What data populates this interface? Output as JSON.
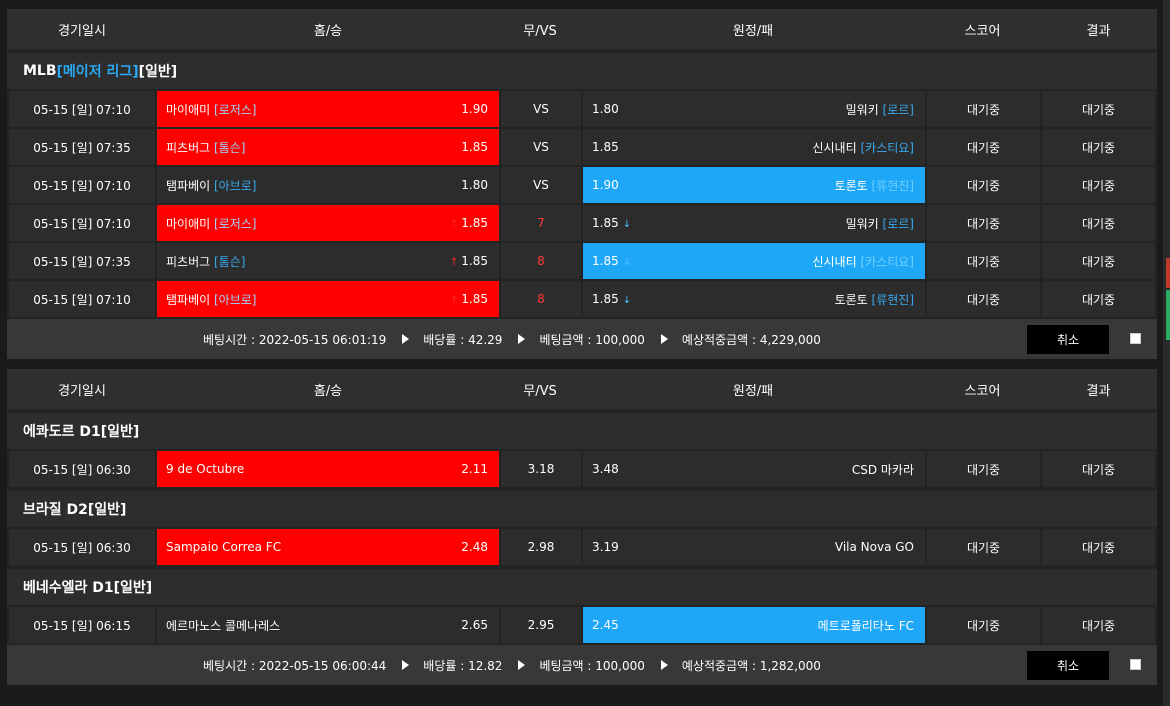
{
  "header": {
    "date": "경기일시",
    "home": "홈/승",
    "vs": "무/VS",
    "away": "원정/패",
    "score": "스코어",
    "result": "결과"
  },
  "slips": [
    {
      "groups": [
        {
          "league": {
            "name": "MLB",
            "tag": "[메이저 리그]",
            "type": "[일반]"
          },
          "rows": [
            {
              "date": "05-15 [일] 07:10",
              "home": "마이애미",
              "home_pitcher": "[로저스]",
              "home_odds": "1.90",
              "home_arrow": "",
              "vs": "VS",
              "vs_red": false,
              "away_odds": "1.80",
              "away_arrow": "",
              "away": "밀워키",
              "away_pitcher": "[로르]",
              "score": "대기중",
              "result": "대기중",
              "pick": "home"
            },
            {
              "date": "05-15 [일] 07:35",
              "home": "피츠버그",
              "home_pitcher": "[톰슨]",
              "home_odds": "1.85",
              "home_arrow": "",
              "vs": "VS",
              "vs_red": false,
              "away_odds": "1.85",
              "away_arrow": "",
              "away": "신시내티",
              "away_pitcher": "[카스티요]",
              "score": "대기중",
              "result": "대기중",
              "pick": "home"
            },
            {
              "date": "05-15 [일] 07:10",
              "home": "탬파베이",
              "home_pitcher": "[아브로]",
              "home_odds": "1.80",
              "home_arrow": "",
              "vs": "VS",
              "vs_red": false,
              "away_odds": "1.90",
              "away_arrow": "",
              "away": "토론토",
              "away_pitcher": "[류현진]",
              "score": "대기중",
              "result": "대기중",
              "pick": "away"
            },
            {
              "date": "05-15 [일] 07:10",
              "home": "마이애미",
              "home_pitcher": "[로저스]",
              "home_odds": "1.85",
              "home_arrow": "↑",
              "vs": "7",
              "vs_red": true,
              "away_odds": "1.85",
              "away_arrow": "↓",
              "away": "밀워키",
              "away_pitcher": "[로르]",
              "score": "대기중",
              "result": "대기중",
              "pick": "home"
            },
            {
              "date": "05-15 [일] 07:35",
              "home": "피츠버그",
              "home_pitcher": "[톰슨]",
              "home_odds": "1.85",
              "home_arrow": "↑",
              "vs": "8",
              "vs_red": true,
              "away_odds": "1.85",
              "away_arrow": "↓",
              "away": "신시내티",
              "away_pitcher": "[카스티요]",
              "score": "대기중",
              "result": "대기중",
              "pick": "away"
            },
            {
              "date": "05-15 [일] 07:10",
              "home": "탬파베이",
              "home_pitcher": "[아브로]",
              "home_odds": "1.85",
              "home_arrow": "↑",
              "vs": "8",
              "vs_red": true,
              "away_odds": "1.85",
              "away_arrow": "↓",
              "away": "토론토",
              "away_pitcher": "[류현진]",
              "score": "대기중",
              "result": "대기중",
              "pick": "home"
            }
          ]
        }
      ],
      "summary": {
        "time": "베팅시간 : 2022-05-15 06:01:19",
        "rate": "배당률 : 42.29",
        "amount": "베팅금액 : 100,000",
        "expected": "예상적중금액 : 4,229,000",
        "cancel": "취소"
      }
    },
    {
      "groups": [
        {
          "league": {
            "name": "에콰도르 D1",
            "tag": "",
            "type": "[일반]"
          },
          "rows": [
            {
              "date": "05-15 [일] 06:30",
              "home": "9 de Octubre",
              "home_pitcher": "",
              "home_odds": "2.11",
              "home_arrow": "",
              "vs": "3.18",
              "vs_red": false,
              "away_odds": "3.48",
              "away_arrow": "",
              "away": "CSD 마카라",
              "away_pitcher": "",
              "score": "대기중",
              "result": "대기중",
              "pick": "home"
            }
          ]
        },
        {
          "league": {
            "name": "브라질 D2",
            "tag": "",
            "type": "[일반]"
          },
          "rows": [
            {
              "date": "05-15 [일] 06:30",
              "home": "Sampaio Correa FC",
              "home_pitcher": "",
              "home_odds": "2.48",
              "home_arrow": "",
              "vs": "2.98",
              "vs_red": false,
              "away_odds": "3.19",
              "away_arrow": "",
              "away": "Vila Nova GO",
              "away_pitcher": "",
              "score": "대기중",
              "result": "대기중",
              "pick": "home"
            }
          ]
        },
        {
          "league": {
            "name": "베네수엘라 D1",
            "tag": "",
            "type": "[일반]"
          },
          "rows": [
            {
              "date": "05-15 [일] 06:15",
              "home": "에르마노스 콜메나레스",
              "home_pitcher": "",
              "home_odds": "2.65",
              "home_arrow": "",
              "vs": "2.95",
              "vs_red": false,
              "away_odds": "2.45",
              "away_arrow": "",
              "away": "메트로폴리타노 FC",
              "away_pitcher": "",
              "score": "대기중",
              "result": "대기중",
              "pick": "away"
            }
          ]
        }
      ],
      "summary": {
        "time": "베팅시간 : 2022-05-15 06:00:44",
        "rate": "배당률 : 12.82",
        "amount": "베팅금액 : 100,000",
        "expected": "예상적중금액 : 1,282,000",
        "cancel": "취소"
      }
    }
  ],
  "colors": {
    "home_pick": "#fe0000",
    "away_pick": "#1fa7f7",
    "accent_blue": "#2aa9f5",
    "odds_up": "#ff2a2a",
    "odds_down": "#4fc3ff"
  }
}
